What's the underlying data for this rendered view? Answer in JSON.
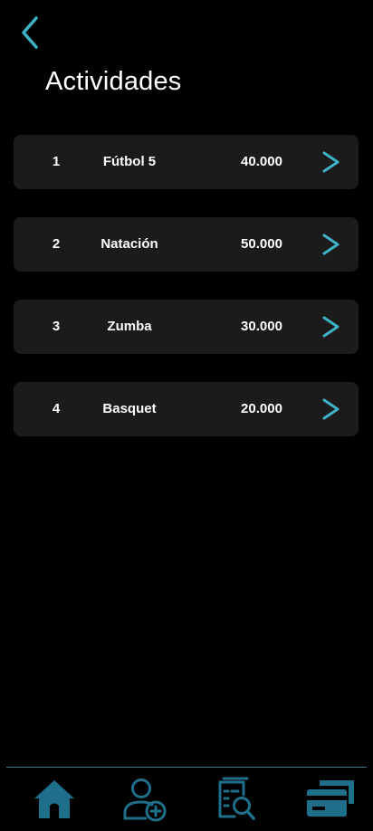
{
  "header": {
    "back_icon": "chevron-left-icon",
    "title": "Actividades"
  },
  "activities": [
    {
      "number": "1",
      "name": "Fútbol 5",
      "price": "40.000"
    },
    {
      "number": "2",
      "name": "Natación",
      "price": "50.000"
    },
    {
      "number": "3",
      "name": "Zumba",
      "price": "30.000"
    },
    {
      "number": "4",
      "name": "Basquet",
      "price": "20.000"
    }
  ],
  "row_action_icon": "chevron-right-icon",
  "bottom_nav": [
    {
      "icon": "home-icon"
    },
    {
      "icon": "add-user-icon"
    },
    {
      "icon": "search-document-icon"
    },
    {
      "icon": "payment-card-icon"
    }
  ],
  "colors": {
    "background": "#000000",
    "card": "#1b1b1c",
    "accent": "#3fb3c8",
    "nav_icon": "#1f6f8a",
    "text": "#ffffff"
  }
}
